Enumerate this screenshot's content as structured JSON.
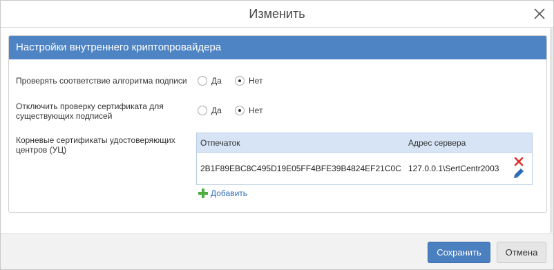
{
  "dialog": {
    "title": "Изменить"
  },
  "panel": {
    "header": "Настройки внутреннего криптопровайдера",
    "settings": [
      {
        "label_lines": [
          "Проверять соответствие алгоритма подписи"
        ],
        "options": [
          "Да",
          "Нет"
        ],
        "selected": "Нет"
      },
      {
        "label_lines": [
          "Отключить проверку сертификата для",
          "существующих подписей"
        ],
        "options": [
          "Да",
          "Нет"
        ],
        "selected": "Нет"
      }
    ],
    "certs": {
      "label_lines": [
        "Корневые сертификаты удостоверяющих",
        "центров (УЦ)"
      ],
      "columns": [
        "Отпечаток",
        "Адрес сервера"
      ],
      "rows": [
        {
          "thumbprint": "2B1F89EBC8C495D19E05FF4BFE39B4824EF21C0C",
          "server": "127.0.0.1\\SertCentr2003"
        }
      ],
      "add_label": "Добавить"
    }
  },
  "footer": {
    "save_label": "Сохранить",
    "cancel_label": "Отмена"
  },
  "colors": {
    "accent": "#4f84c4",
    "grid_header": "#d6e4f5",
    "delete": "#e0302a",
    "edit": "#2d6cb5",
    "add": "#4caf3f"
  }
}
